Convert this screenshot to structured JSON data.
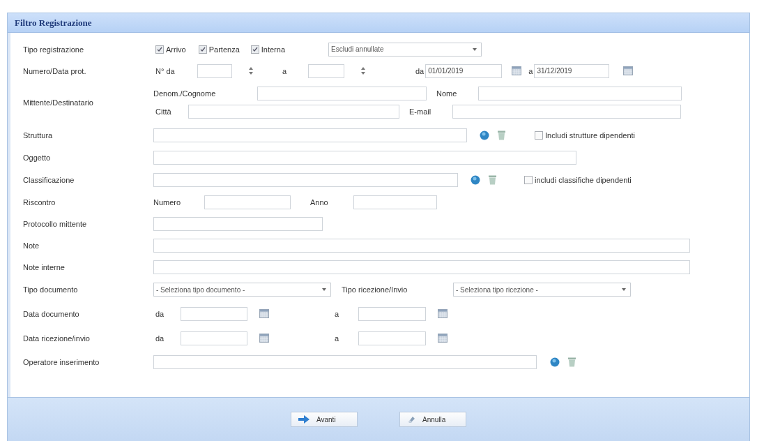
{
  "panel": {
    "title": "Filtro Registrazione"
  },
  "rows": [
    {
      "kind": "checks",
      "label": "Tipo registrazione",
      "checks": [
        {
          "label": "Arrivo",
          "checked": true
        },
        {
          "label": "Partenza",
          "checked": true
        },
        {
          "label": "Interna",
          "checked": true
        }
      ],
      "select": "Escludi annullate"
    },
    {
      "kind": "numdate",
      "label": "Numero/Data prot.",
      "from_label": "N° da",
      "to_label": "a",
      "date_from_label": "da",
      "date_from": "01/01/2019",
      "date_to_label": "a",
      "date_to": "31/12/2019"
    },
    {
      "kind": "party",
      "label": "Mittente/Destinatario",
      "fields": [
        "Denom./Cognome",
        "Nome",
        "Città",
        "E-mail"
      ]
    },
    {
      "kind": "lookup",
      "label": "Struttura",
      "option": {
        "label": "Includi strutture dipendenti",
        "checked": false
      }
    },
    {
      "kind": "text",
      "label": "Oggetto"
    },
    {
      "kind": "lookup",
      "label": "Classificazione",
      "option": {
        "label": "includi classifiche dipendenti",
        "checked": false
      }
    },
    {
      "kind": "pair",
      "label": "Riscontro",
      "fields": [
        "Numero",
        "Anno"
      ]
    },
    {
      "kind": "text",
      "label": "Protocollo mittente"
    },
    {
      "kind": "text",
      "label": "Note"
    },
    {
      "kind": "text",
      "label": "Note interne"
    },
    {
      "kind": "selects",
      "label": "Tipo documento",
      "select": "- Seleziona tipo documento -",
      "second_label": "Tipo ricezione/Invio",
      "second_select": "- Seleziona tipo ricezione -"
    },
    {
      "kind": "range",
      "label": "Data documento",
      "from_label": "da",
      "to_label": "a"
    },
    {
      "kind": "range",
      "label": "Data ricezione/invio",
      "from_label": "da",
      "to_label": "a"
    },
    {
      "kind": "lookup",
      "label": "Operatore inserimento"
    }
  ],
  "buttons": [
    {
      "kind": "next",
      "label": "Avanti"
    },
    {
      "kind": "cancel",
      "label": "Annulla"
    }
  ]
}
